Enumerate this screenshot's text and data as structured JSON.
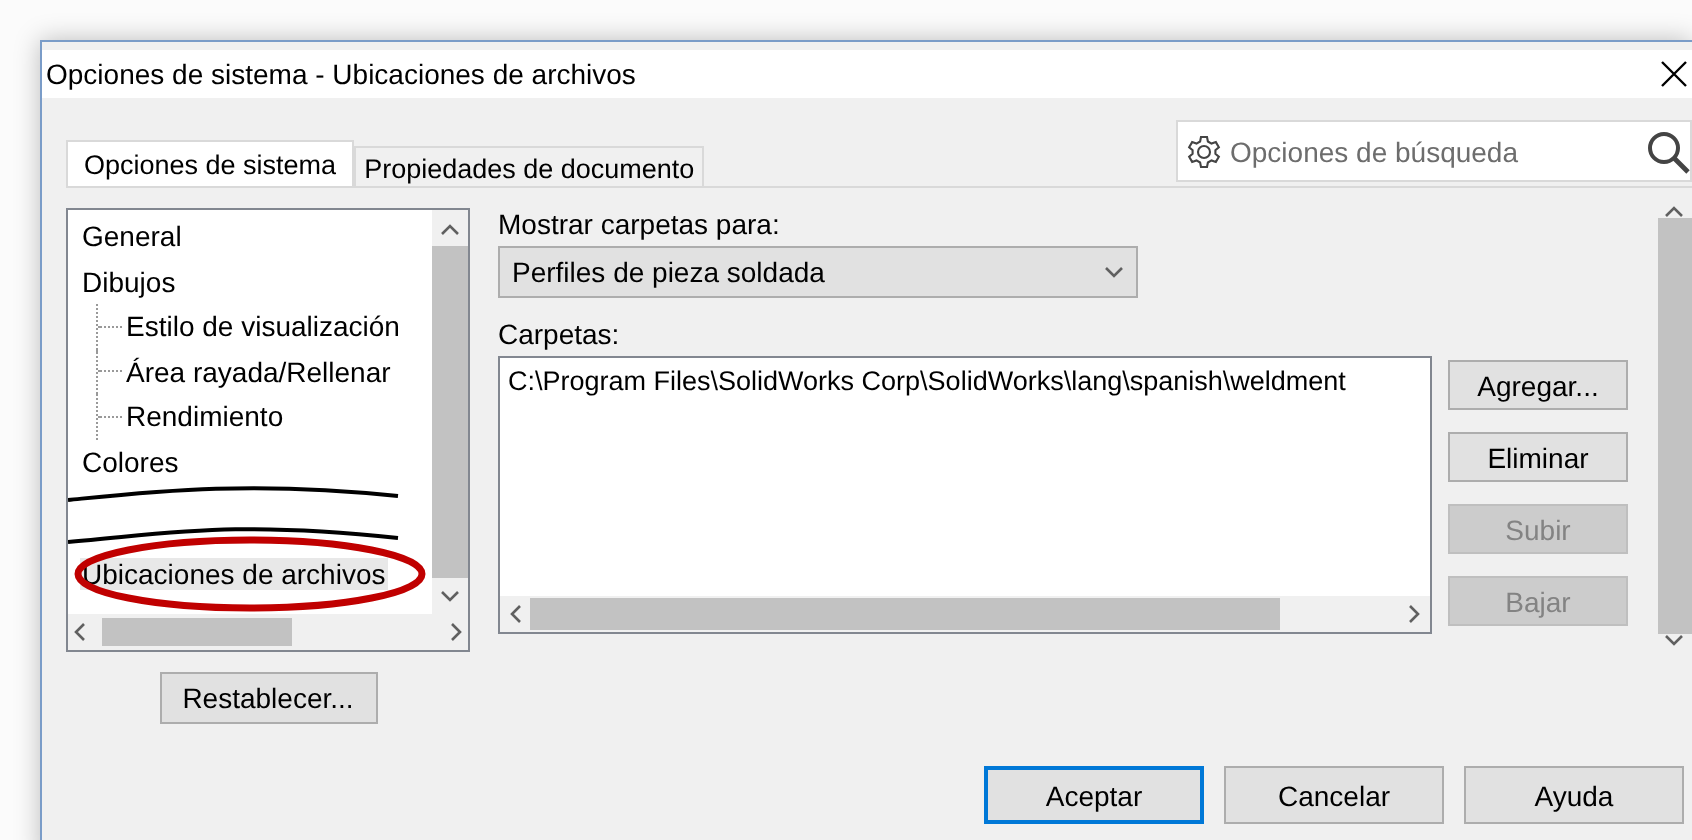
{
  "window": {
    "title": "Opciones de sistema - Ubicaciones de archivos"
  },
  "tabs": [
    {
      "label": "Opciones de sistema",
      "selected": true
    },
    {
      "label": "Propiedades de documento",
      "selected": false
    }
  ],
  "search": {
    "placeholder": "Opciones de búsqueda"
  },
  "tree": [
    {
      "label": "General",
      "selected": false,
      "cut_after": false,
      "circled": false
    },
    {
      "label": "Dibujos",
      "selected": false,
      "cut_after": false,
      "circled": false,
      "children": [
        {
          "label": "Estilo de visualización",
          "selected": false
        },
        {
          "label": "Área rayada/Rellenar",
          "selected": false
        },
        {
          "label": "Rendimiento",
          "selected": false
        }
      ]
    },
    {
      "label": "Colores",
      "selected": false,
      "cut_after": true,
      "circled": false
    },
    {
      "label": "Ubicaciones de archivos",
      "selected": true,
      "cut_after": false,
      "circled": true
    }
  ],
  "reset_button": "Restablecer...",
  "show_folders": {
    "label": "Mostrar carpetas para:",
    "value": "Perfiles de pieza soldada"
  },
  "folders": {
    "label": "Carpetas:",
    "items": [
      "C:\\Program Files\\SolidWorks Corp\\SolidWorks\\lang\\spanish\\weldment"
    ]
  },
  "side_buttons": [
    {
      "label": "Agregar...",
      "disabled": false
    },
    {
      "label": "Eliminar",
      "disabled": false
    },
    {
      "label": "Subir",
      "disabled": true
    },
    {
      "label": "Bajar",
      "disabled": true
    }
  ],
  "footer_buttons": [
    {
      "label": "Aceptar",
      "default": true
    },
    {
      "label": "Cancelar",
      "default": false
    },
    {
      "label": "Ayuda",
      "default": false
    }
  ]
}
